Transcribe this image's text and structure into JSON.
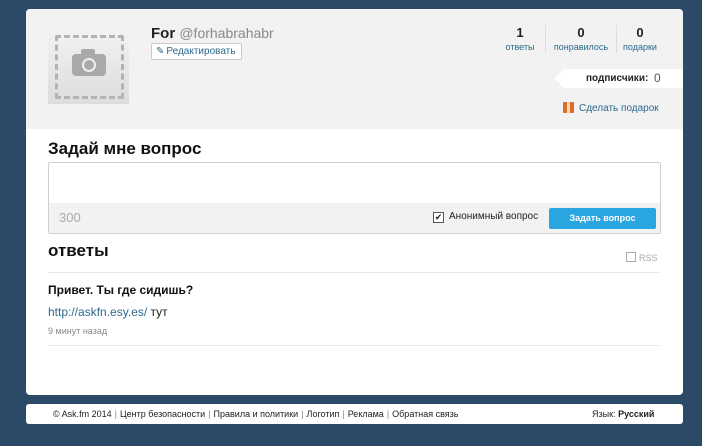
{
  "profile": {
    "name": "For",
    "handle": "@forhabrahabr",
    "edit_label": "Редактировать",
    "stats": [
      {
        "value": "1",
        "label": "ответы"
      },
      {
        "value": "0",
        "label": "понравилось"
      },
      {
        "value": "0",
        "label": "подарки"
      }
    ],
    "subscribers_label": "подписчики:",
    "subscribers_count": "0",
    "gift_label": "Сделать подарок"
  },
  "ask": {
    "title": "Задай мне вопрос",
    "counter": "300",
    "anonymous_label": "Анонимный вопрос",
    "anonymous_checked": true,
    "submit_label": "Задать вопрос"
  },
  "answers": {
    "title": "ответы",
    "rss_label": "RSS",
    "items": [
      {
        "question": "Привет. Ты где сидишь?",
        "answer_link": "http://askfn.esy.es/",
        "answer_text": " тут",
        "time": "9 минут назад"
      }
    ]
  },
  "footer": {
    "copyright": "© Ask.fm 2014",
    "links": [
      "Центр безопасности",
      "Правила и политики",
      "Логотип",
      "Реклама",
      "Обратная связь"
    ],
    "language_label": "Язык:",
    "language_value": "Русский"
  }
}
